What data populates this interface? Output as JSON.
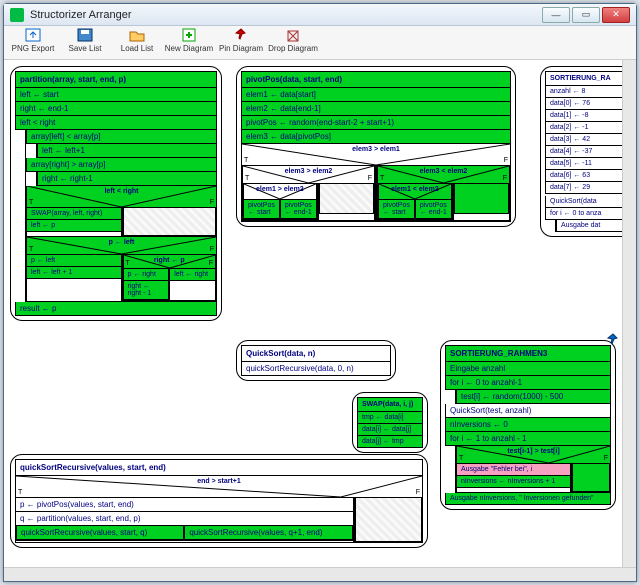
{
  "window": {
    "title": "Structorizer Arranger"
  },
  "toolbar": {
    "items": [
      {
        "label": "PNG Export",
        "icon": "export-icon",
        "color": "#06c"
      },
      {
        "label": "Save List",
        "icon": "save-icon",
        "color": "#06c"
      },
      {
        "label": "Load List",
        "icon": "open-icon",
        "color": "#c80"
      },
      {
        "label": "New Diagram",
        "icon": "new-icon",
        "color": "#0a0"
      },
      {
        "label": "Pin Diagram",
        "icon": "pin-icon",
        "color": "#c00"
      },
      {
        "label": "Drop Diagram",
        "icon": "drop-icon",
        "color": "#a33"
      }
    ]
  },
  "partition": {
    "title": "partition(array, start, end, p)",
    "l1": "left ← start",
    "l2": "right ← end-1",
    "loop1": "left < right",
    "c1": "array[left] < array[p]",
    "b1": "left ← left+1",
    "c2": "array[right] > array[p]",
    "b2": "right ← right-1",
    "cond_inner": "left < right",
    "swap": "SWAP(array, left, right)",
    "lp": "left ← p",
    "cond_p": "p ← left",
    "rp": "right ← p",
    "pl": "p ← left",
    "ll1": "left ← left + 1",
    "pr": "p ← right",
    "rr1": "right ← right - 1",
    "res": "result ← p",
    "ltr": "left ← right",
    "T": "T",
    "F": "F"
  },
  "pivot": {
    "title": "pivotPos(data, start, end)",
    "e1": "elem1 ← data[start]",
    "e2": "elem2 ← data[end-1]",
    "pp": "pivotPos ← random(end-start-2 + start+1)",
    "e3": "elem3 ← data[pivotPos]",
    "c_top": "elem3 > elem1",
    "c_l": "elem3 > elem2",
    "c_r": "elem3 < elem2",
    "c_ll": "elem1 > elem2",
    "c_rr": "elem1 < elem2",
    "ps": "pivotPos ← start",
    "pe": "pivotPos ← end-1",
    "T": "T",
    "F": "F"
  },
  "rahmen": {
    "title": "SORTIERUNG_RA",
    "lines": [
      "anzahl ← 8",
      "data[0] ← 76",
      "data[1] ← -8",
      "data[2] ← -1",
      "data[3] ← 42",
      "data[4] ← -37",
      "data[5] ← -11",
      "data[6] ← 63",
      "data[7] ← 29"
    ],
    "call": "QuickSort(data",
    "loop": "for i ← 0 to anza",
    "out": "Ausgabe dat"
  },
  "qs": {
    "title": "QuickSort(data, n)",
    "call": "quickSortRecursive(data, 0, n)"
  },
  "swap": {
    "title": "SWAP(data, i, j)",
    "l1": "tmp ← data[i]",
    "l2": "data[i] ← data[j]",
    "l3": "data[j] ← tmp"
  },
  "rahmen3": {
    "title": "SORTIERUNG_RAHMEN3",
    "in": "Eingabe anzahl",
    "loop1": "for i ← 0 to anzahl-1",
    "rand": "test[i] ← random(1000) - 500",
    "call": "QuickSort(test, anzahl)",
    "ninv0": "nInversions ← 0",
    "loop2": "for i ← 1 to anzahl - 1",
    "cond": "test[i-1] > test[i]",
    "err": "Ausgabe \"Fehler bei\", i",
    "inc": "nInversions ← nInversions + 1",
    "out": "Ausgabe nInversions, \" Inversionen gefunden\"",
    "T": "T",
    "F": "F"
  },
  "qsr": {
    "title": "quickSortRecursive(values, start, end)",
    "cond": "end > start+1",
    "p": "p ← pivotPos(values, start, end)",
    "q": "q ← partition(values, start, end, p)",
    "r1": "quickSortRecursive(values, start, q)",
    "r2": "quickSortRecursive(values, q+1, end)",
    "T": "T",
    "F": "F"
  }
}
